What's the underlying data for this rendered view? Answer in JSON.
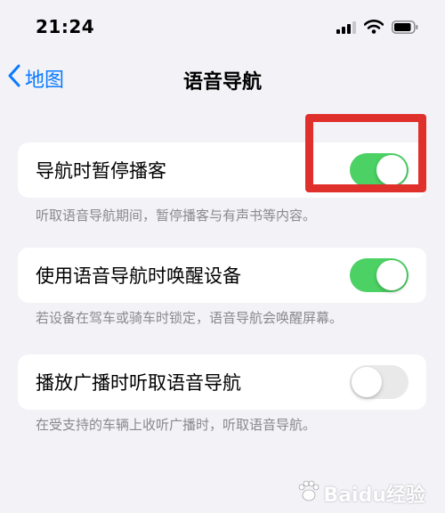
{
  "status_bar": {
    "time": "21:24",
    "icons": [
      "cellular-signal-icon",
      "wifi-icon",
      "battery-icon"
    ]
  },
  "nav": {
    "back_label": "地图",
    "title": "语音导航"
  },
  "settings": [
    {
      "label": "导航时暂停播客",
      "enabled": true,
      "note": "听取语音导航期间，暂停播客与有声书等内容。"
    },
    {
      "label": "使用语音导航时唤醒设备",
      "enabled": true,
      "note": "若设备在驾车或骑车时锁定，语音导航会唤醒屏幕。"
    },
    {
      "label": "播放广播时听取语音导航",
      "enabled": false,
      "note": "在受支持的车辆上收听广播时，听取语音导航。"
    }
  ],
  "watermark": {
    "text": "Baidu经验"
  },
  "colors": {
    "accent": "#0a7aff",
    "toggle_on": "#4cd164",
    "toggle_off": "#e9e9ea",
    "highlight": "#e0302c",
    "background": "#f2f2f7"
  }
}
